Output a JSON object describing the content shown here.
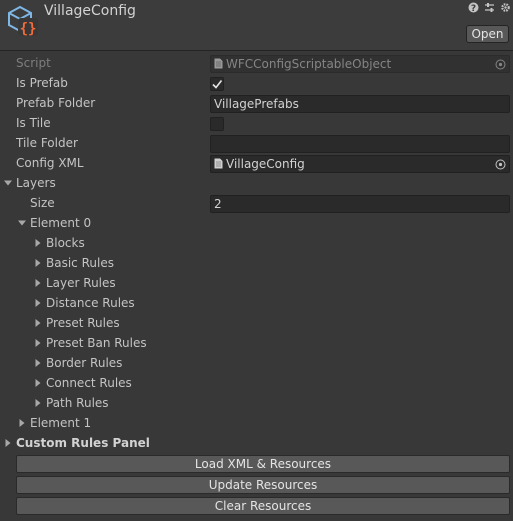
{
  "header": {
    "title": "VillageConfig",
    "open_label": "Open",
    "icons": [
      "help-icon",
      "preset-icon",
      "settings-icon"
    ]
  },
  "fields": {
    "script": {
      "label": "Script",
      "value": "WFCConfigScriptableObject"
    },
    "is_prefab": {
      "label": "Is Prefab",
      "checked": true
    },
    "prefab_folder": {
      "label": "Prefab Folder",
      "value": "VillagePrefabs"
    },
    "is_tile": {
      "label": "Is Tile",
      "checked": false
    },
    "tile_folder": {
      "label": "Tile Folder",
      "value": ""
    },
    "config_xml": {
      "label": "Config XML",
      "value": "VillageConfig"
    }
  },
  "layers": {
    "label": "Layers",
    "size_label": "Size",
    "size_value": "2",
    "element0": {
      "label": "Element 0",
      "children": [
        "Blocks",
        "Basic Rules",
        "Layer Rules",
        "Distance Rules",
        "Preset Rules",
        "Preset Ban Rules",
        "Border Rules",
        "Connect Rules",
        "Path Rules"
      ]
    },
    "element1": {
      "label": "Element 1"
    }
  },
  "custom_rules_panel": {
    "label": "Custom Rules Panel"
  },
  "buttons": {
    "load": "Load XML & Resources",
    "update": "Update Resources",
    "clear": "Clear Resources"
  },
  "colors": {
    "background": "#383838",
    "header": "#3c3c3c",
    "field": "#2a2a2a",
    "button": "#585858",
    "text": "#c4c4c4",
    "icon_orange": "#f26b3a",
    "icon_blue": "#7fb7e6"
  }
}
